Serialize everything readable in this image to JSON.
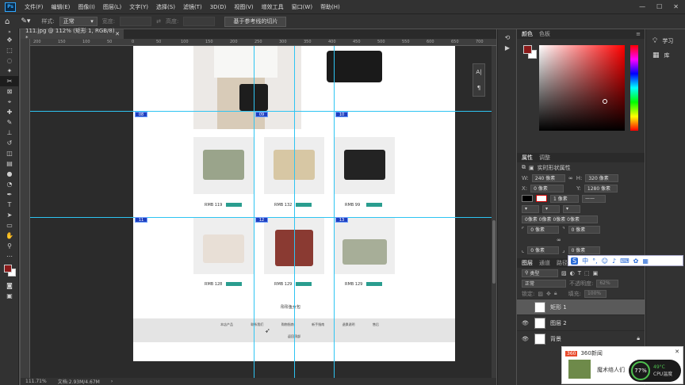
{
  "menubar": {
    "logo": "Ps",
    "items": [
      "文件(F)",
      "编辑(E)",
      "图像(I)",
      "图层(L)",
      "文字(Y)",
      "选择(S)",
      "滤镜(T)",
      "3D(D)",
      "视图(V)",
      "增效工具",
      "窗口(W)",
      "帮助(H)"
    ]
  },
  "options": {
    "style_label": "样式:",
    "style_value": "正常",
    "width_label": "宽度:",
    "height_label": "高度:",
    "slice_button": "基于参考线的切片"
  },
  "document": {
    "tab_title": "111.jpg @ 112% (矩形 1, RGB/8) *",
    "zoom": "111.71%",
    "doc_info": "文档:2.93M/4.67M",
    "ruler_marks": [
      "200",
      "150",
      "100",
      "50",
      "0",
      "50",
      "100",
      "150",
      "200",
      "250",
      "300",
      "350",
      "400",
      "450",
      "500",
      "550",
      "600",
      "650",
      "700"
    ],
    "prices": [
      "RMB 119",
      "RMB 132",
      "RMB 99",
      "RMB 128",
      "RMB 129",
      "RMB 129"
    ],
    "footer_title": "彤彤鱼女包",
    "footer_links": [
      "本店产品",
      "联系我们",
      "购物指南",
      "新手指南",
      "退换说明",
      "售后"
    ],
    "footer_back": "返回顶部",
    "slice_tags": [
      "08",
      "09",
      "10",
      "11",
      "12",
      "13"
    ]
  },
  "color_panel": {
    "tabs": [
      "颜色",
      "色板"
    ],
    "foreground": "#8b1a1a",
    "background": "#ffffff"
  },
  "properties_panel": {
    "tabs": [
      "属性",
      "调整"
    ],
    "subtitle": "实时形状属性",
    "w_label": "W:",
    "w_value": "240 像素",
    "h_label": "H:",
    "h_value": "320 像素",
    "x_label": "X:",
    "x_value": "0 像素",
    "y_label": "Y:",
    "y_value": "1280 像素",
    "stroke_value": "1 像素",
    "corner_all": "0像素 0像素 0像素 0像素",
    "corner_1": "0 像素",
    "corner_2": "0 像素",
    "corner_3": "0 像素",
    "corner_4": "0 像素"
  },
  "layers_panel": {
    "tabs": [
      "图层",
      "通道",
      "路径"
    ],
    "filter_label": "类型",
    "blend_mode": "正常",
    "opacity_label": "不透明度:",
    "opacity_value": "62%",
    "lock_label": "锁定:",
    "fill_label": "填充:",
    "fill_value": "100%",
    "layers": [
      {
        "name": "矩形 1",
        "visible": false,
        "selected": true
      },
      {
        "name": "图层 2",
        "visible": true,
        "selected": false
      },
      {
        "name": "背景",
        "visible": true,
        "selected": false
      }
    ]
  },
  "side_icons": [
    "学习",
    "库"
  ],
  "news": {
    "app": "360新闻",
    "headline": "魔术络人们"
  },
  "monitor": {
    "cpu_percent": "77%",
    "temp": "49°C",
    "label": "CPU温度"
  },
  "ime": {
    "mode": "中"
  }
}
